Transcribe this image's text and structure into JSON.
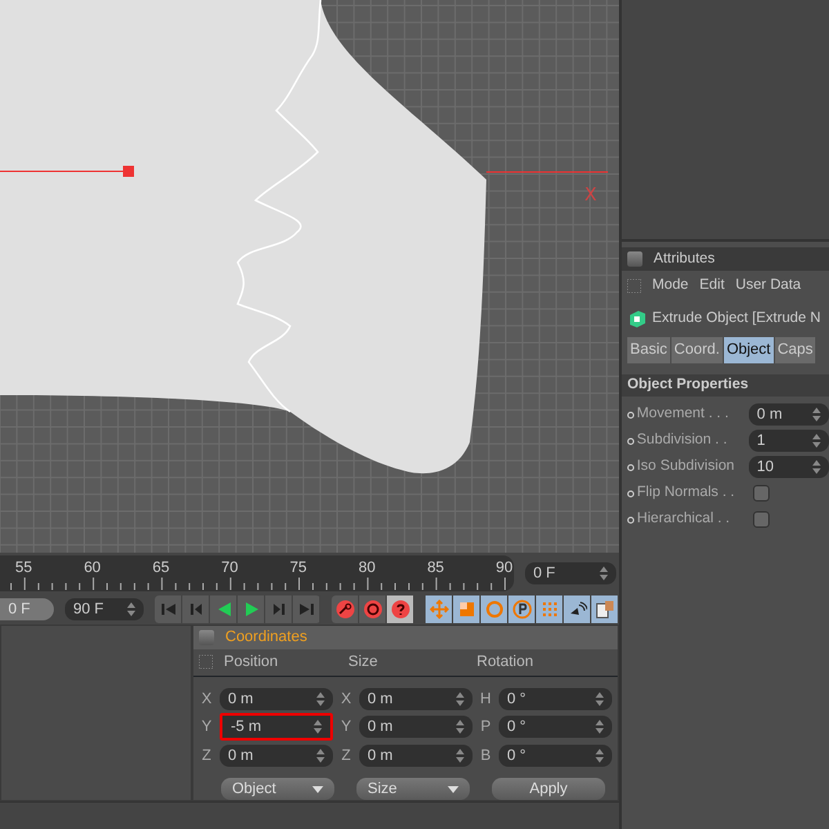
{
  "viewport": {
    "axis_label": "X"
  },
  "timeline": {
    "ticks": [
      "55",
      "60",
      "65",
      "70",
      "75",
      "80",
      "85",
      "90"
    ],
    "current_frame": "0 F"
  },
  "transport": {
    "start_field": "0 F",
    "end_field": "90 F"
  },
  "attributes": {
    "title": "Attributes",
    "menu": [
      "Mode",
      "Edit",
      "User Data"
    ],
    "object_title": "Extrude Object [Extrude N",
    "tabs": [
      {
        "label": "Basic",
        "selected": false
      },
      {
        "label": "Coord.",
        "selected": false
      },
      {
        "label": "Object",
        "selected": true
      },
      {
        "label": "Caps",
        "selected": false
      }
    ],
    "section": "Object Properties",
    "properties": [
      {
        "kind": "field",
        "label": "Movement . . .",
        "value": "0 m"
      },
      {
        "kind": "field",
        "label": "Subdivision . .",
        "value": "1"
      },
      {
        "kind": "field",
        "label": "Iso Subdivision",
        "value": "10"
      },
      {
        "kind": "checkbox",
        "label": "Flip Normals . .",
        "checked": false
      },
      {
        "kind": "checkbox",
        "label": "Hierarchical . .",
        "checked": false
      }
    ]
  },
  "coordinates": {
    "title": "Coordinates",
    "columns": [
      "Position",
      "Size",
      "Rotation"
    ],
    "rows": [
      {
        "cells": [
          {
            "axis": "X",
            "value": "0 m",
            "highlighted": false
          },
          {
            "axis": "X",
            "value": "0 m",
            "highlighted": false
          },
          {
            "axis": "H",
            "value": "0 °",
            "highlighted": false
          }
        ]
      },
      {
        "cells": [
          {
            "axis": "Y",
            "value": "-5 m",
            "highlighted": true
          },
          {
            "axis": "Y",
            "value": "0 m",
            "highlighted": false
          },
          {
            "axis": "P",
            "value": "0 °",
            "highlighted": false
          }
        ]
      },
      {
        "cells": [
          {
            "axis": "Z",
            "value": "0 m",
            "highlighted": false
          },
          {
            "axis": "Z",
            "value": "0 m",
            "highlighted": false
          },
          {
            "axis": "B",
            "value": "0 °",
            "highlighted": false
          }
        ]
      }
    ],
    "dropdowns": [
      "Object",
      "Size"
    ],
    "apply": "Apply"
  }
}
